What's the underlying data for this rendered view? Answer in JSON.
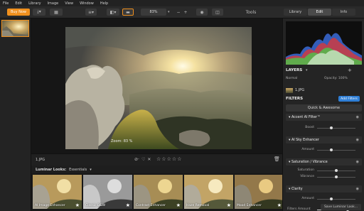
{
  "menu": [
    "File",
    "Edit",
    "Library",
    "Image",
    "View",
    "Window",
    "Help"
  ],
  "toolbar": {
    "buy_label": "Buy Now",
    "zoom_value": "83%",
    "tools_label": "Tools",
    "tabs": [
      "Library",
      "Edit",
      "Info"
    ],
    "active_tab": "Edit"
  },
  "canvas": {
    "zoom_overlay": "Zoom: 83 %",
    "file_name": "1.JPG"
  },
  "rating": {
    "stars_total": 5,
    "stars_filled": 0
  },
  "looks": {
    "title": "Luminar Looks:",
    "category": "Essentials",
    "items": [
      {
        "label": "AI Image Enhancer"
      },
      {
        "label": "Classic B&W"
      },
      {
        "label": "Contrast Enhancer"
      },
      {
        "label": "Haze Removal"
      },
      {
        "label": "Mood Enhancer"
      }
    ]
  },
  "layers": {
    "title": "LAYERS",
    "blend_mode": "Normal",
    "opacity_label": "Opacity: 100%",
    "layer_name": "1.JPG"
  },
  "filters": {
    "title": "FILTERS",
    "add_label": "Add Filters",
    "preset_label": "Quick & Awesome",
    "items": [
      {
        "name": "Accent AI Filter™",
        "sliders": [
          {
            "label": "Boost",
            "value": 0.35
          }
        ]
      },
      {
        "name": "AI Sky Enhancer",
        "sliders": [
          {
            "label": "Amount",
            "value": 0.35
          }
        ]
      },
      {
        "name": "Saturation / Vibrance",
        "sliders": [
          {
            "label": "Saturation",
            "value": 0.5
          },
          {
            "label": "Vibrance",
            "value": 0.5
          }
        ]
      },
      {
        "name": "Clarity",
        "sliders": [
          {
            "label": "Amount",
            "value": 0.35
          }
        ]
      }
    ],
    "amount_label": "Filters Amount",
    "amount_value": "100",
    "amount_fraction": 1.0
  },
  "save_label": "Save Luminar Look...",
  "colors": {
    "accent": "#f0901e",
    "blue": "#2f7fd6"
  }
}
